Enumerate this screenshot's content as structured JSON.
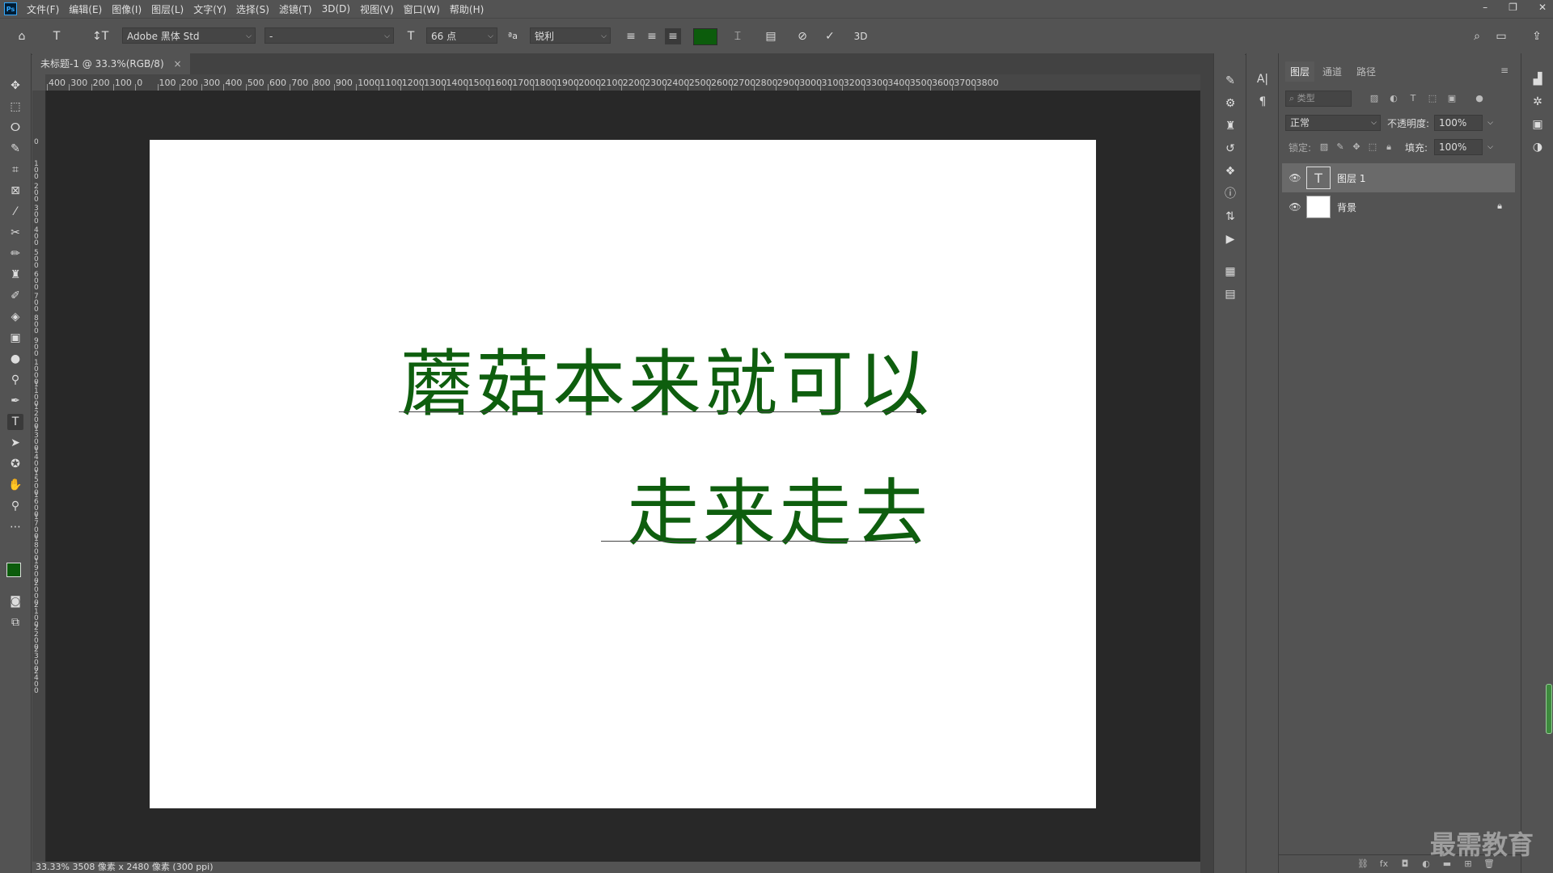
{
  "app": {
    "logo": "Ps"
  },
  "menu": [
    "文件(F)",
    "编辑(E)",
    "图像(I)",
    "图层(L)",
    "文字(Y)",
    "选择(S)",
    "滤镜(T)",
    "3D(D)",
    "视图(V)",
    "窗口(W)",
    "帮助(H)"
  ],
  "window_controls": {
    "minimize": "–",
    "restore": "❐",
    "close": "✕"
  },
  "options": {
    "font_family": "Adobe 黑体 Std",
    "font_style": "-",
    "font_size": "66 点",
    "antialias": "锐利",
    "text_color": "#0c5c0c",
    "three_d": "3D"
  },
  "document": {
    "tab_title": "未标题-1 @ 33.3%(RGB/8)",
    "tab_close": "×",
    "line1": "蘑菇本来就可以",
    "line2": "走来走去",
    "text_color": "#0e5e0e"
  },
  "ruler": {
    "h_labels": [
      "400",
      "300",
      "200",
      "100",
      "0",
      "100",
      "200",
      "300",
      "400",
      "500",
      "600",
      "700",
      "800",
      "900",
      "1000",
      "1100",
      "1200",
      "1300",
      "1400",
      "1500",
      "1600",
      "1700",
      "1800",
      "1900",
      "2000",
      "2100",
      "2200",
      "2300",
      "2400",
      "2500",
      "2600",
      "2700",
      "2800",
      "2900",
      "3000",
      "3100",
      "3200",
      "3300",
      "3400",
      "3500",
      "3600",
      "3700",
      "3800"
    ],
    "v_labels": [
      "0",
      "1 0 0",
      "2 0 0",
      "3 0 0",
      "4 0 0",
      "5 0 0",
      "6 0 0",
      "7 0 0",
      "8 0 0",
      "9 0 0",
      "1 0 0 0",
      "1 1 0 0",
      "1 2 0 0",
      "1 3 0 0",
      "1 4 0 0",
      "1 5 0 0",
      "1 6 0 0",
      "1 7 0 0",
      "1 8 0 0",
      "1 9 0 0",
      "2 0 0 0",
      "2 1 0 0",
      "2 2 0 0",
      "2 3 0 0",
      "2 4 0 0"
    ]
  },
  "status": "33.33%  3508 像素 x 2480 像素 (300 ppi)",
  "layers_panel": {
    "tabs": [
      "图层",
      "通道",
      "路径"
    ],
    "kind_placeholder": "类型",
    "blend_mode": "正常",
    "opacity_label": "不透明度:",
    "opacity_value": "100%",
    "lock_label": "锁定:",
    "fill_label": "填充:",
    "fill_value": "100%",
    "layers": [
      {
        "name": "图层 1",
        "thumb": "T",
        "selected": true
      },
      {
        "name": "背景",
        "thumb": "",
        "locked": true
      }
    ]
  },
  "watermark": "最需教育"
}
